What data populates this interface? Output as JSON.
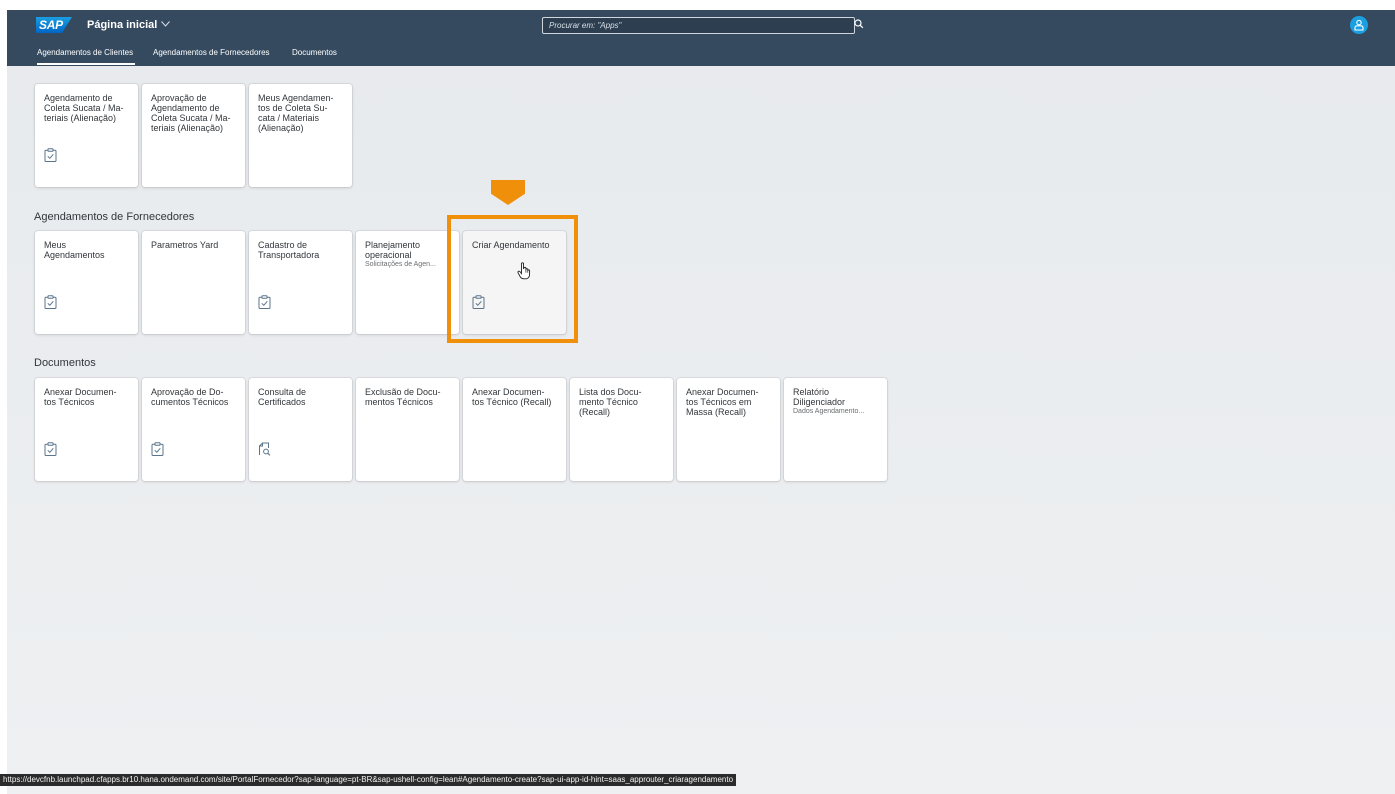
{
  "header": {
    "logo_text": "SAP",
    "app_title": "Página inicial",
    "search_placeholder": "Procurar em: \"Apps\"",
    "tabs": [
      {
        "label": "Agendamentos de Clientes",
        "selected": true
      },
      {
        "label": "Agendamentos de Fornecedores",
        "selected": false
      },
      {
        "label": "Documentos",
        "selected": false
      }
    ],
    "colors": {
      "shell": "#354a5f",
      "accent": "#1a9fe0"
    }
  },
  "groups": {
    "clientes": {
      "tiles": [
        {
          "title": "Agendamento de\nColeta Sucata / Ma-\nteriais (Alienação)",
          "icon": "clipboard-check-icon"
        },
        {
          "title": "Aprovação de\nAgendamento de\nColeta Sucata / Ma-\nteriais (Alienação)",
          "icon": ""
        },
        {
          "title": "Meus Agendamen-\ntos de Coleta Su-\ncata / Materiais\n(Alienação)",
          "icon": ""
        }
      ]
    },
    "fornecedores": {
      "title": "Agendamentos de Fornecedores",
      "tiles": [
        {
          "title": "Meus\nAgendamentos",
          "icon": "clipboard-check-icon"
        },
        {
          "title": "Parametros Yard",
          "icon": ""
        },
        {
          "title": "Cadastro de\nTransportadora",
          "icon": "clipboard-check-icon"
        },
        {
          "title": "Planejamento\noperacional",
          "subtitle": "Solicitações de Agen...",
          "icon": ""
        },
        {
          "title": "Criar Agendamento",
          "icon": "clipboard-check-icon"
        }
      ]
    },
    "documentos": {
      "title": "Documentos",
      "tiles": [
        {
          "title": "Anexar Documen-\ntos Técnicos",
          "icon": "clipboard-check-icon"
        },
        {
          "title": "Aprovação de Do-\ncumentos Técnicos",
          "icon": "clipboard-check-icon"
        },
        {
          "title": "Consulta de\nCertificados",
          "icon": "document-search-icon"
        },
        {
          "title": "Exclusão de Docu-\nmentos Técnicos",
          "icon": ""
        },
        {
          "title": "Anexar Documen-\ntos Técnico (Recall)",
          "icon": ""
        },
        {
          "title": "Lista dos Docu-\nmento Técnico\n(Recall)",
          "icon": ""
        },
        {
          "title": "Anexar Documen-\ntos Técnicos em\nMassa (Recall)",
          "icon": ""
        },
        {
          "title": "Relatório\nDiligenciador",
          "subtitle": "Dados Agendamento...",
          "icon": ""
        }
      ]
    }
  },
  "highlight": {
    "color": "#f0900a",
    "target": "Criar Agendamento"
  },
  "status_bar": {
    "url": "https://devcfnb.launchpad.cfapps.br10.hana.ondemand.com/site/PortalFornecedor?sap-language=pt-BR&sap-ushell-config=lean#Agendamento-create?sap-ui-app-id-hint=saas_approuter_criaragendamento"
  }
}
